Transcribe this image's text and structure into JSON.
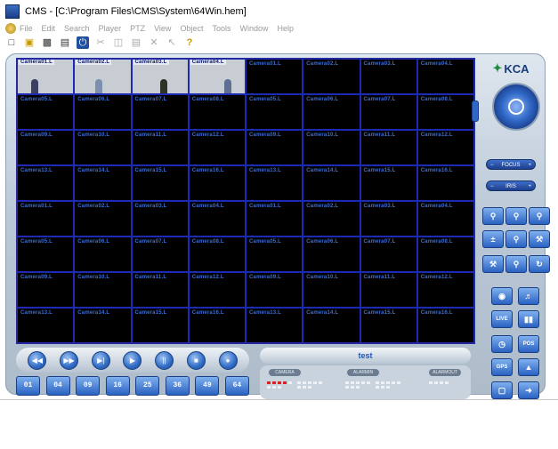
{
  "title_bar": {
    "title": "CMS - [C:\\Program Files\\CMS\\System\\64Win.hem]"
  },
  "menu": {
    "items": [
      "File",
      "Edit",
      "Search",
      "Player",
      "PTZ",
      "View",
      "Object",
      "Tools",
      "Window",
      "Help"
    ]
  },
  "toolbar": {
    "icons": [
      "new-icon",
      "open-icon",
      "save-icon",
      "print-icon",
      "power-icon",
      "cut-icon",
      "copy-icon",
      "paste-icon",
      "delete-icon",
      "pointer-icon",
      "help-icon"
    ]
  },
  "grid": {
    "rows": [
      [
        "Camera01.L",
        "Camera02.L",
        "Camera03.L",
        "Camera04.L",
        "Camera01.L",
        "Camera02.L",
        "Camera03.L",
        "Camera04.L"
      ],
      [
        "Camera05.L",
        "Camera06.L",
        "Camera07.L",
        "Camera08.L",
        "Camera05.L",
        "Camera06.L",
        "Camera07.L",
        "Camera08.L"
      ],
      [
        "Camera09.L",
        "Camera10.L",
        "Camera11.L",
        "Camera12.L",
        "Camera09.L",
        "Camera10.L",
        "Camera11.L",
        "Camera12.L"
      ],
      [
        "Camera13.L",
        "Camera14.L",
        "Camera15.L",
        "Camera16.L",
        "Camera13.L",
        "Camera14.L",
        "Camera15.L",
        "Camera16.L"
      ],
      [
        "Camera01.L",
        "Camera02.L",
        "Camera03.L",
        "Camera04.L",
        "Camera01.L",
        "Camera02.L",
        "Camera03.L",
        "Camera04.L"
      ],
      [
        "Camera05.L",
        "Camera06.L",
        "Camera07.L",
        "Camera08.L",
        "Camera05.L",
        "Camera06.L",
        "Camera07.L",
        "Camera08.L"
      ],
      [
        "Camera09.L",
        "Camera10.L",
        "Camera11.L",
        "Camera12.L",
        "Camera09.L",
        "Camera10.L",
        "Camera11.L",
        "Camera12.L"
      ],
      [
        "Camera13.L",
        "Camera14.L",
        "Camera15.L",
        "Camera16.L",
        "Camera13.L",
        "Camera14.L",
        "Camera15.L",
        "Camera16.L"
      ]
    ]
  },
  "playback": {
    "buttons": [
      "rewind",
      "fast-forward",
      "step",
      "play",
      "pause",
      "stop",
      "record"
    ]
  },
  "split": {
    "labels": [
      "01",
      "04",
      "09",
      "16",
      "25",
      "36",
      "49",
      "64"
    ]
  },
  "status": {
    "name": "test",
    "alarm_labels": [
      "CAMERA",
      "ALARMIN",
      "ALARMOUT"
    ]
  },
  "ptz": {
    "logo": "KCA",
    "focus_label": "FOCUS",
    "iris_label": "IRIS",
    "minus": "−",
    "plus": "+"
  },
  "side_buttons": {
    "live": "LIVE",
    "pos": "POS",
    "gps": "GPS"
  }
}
